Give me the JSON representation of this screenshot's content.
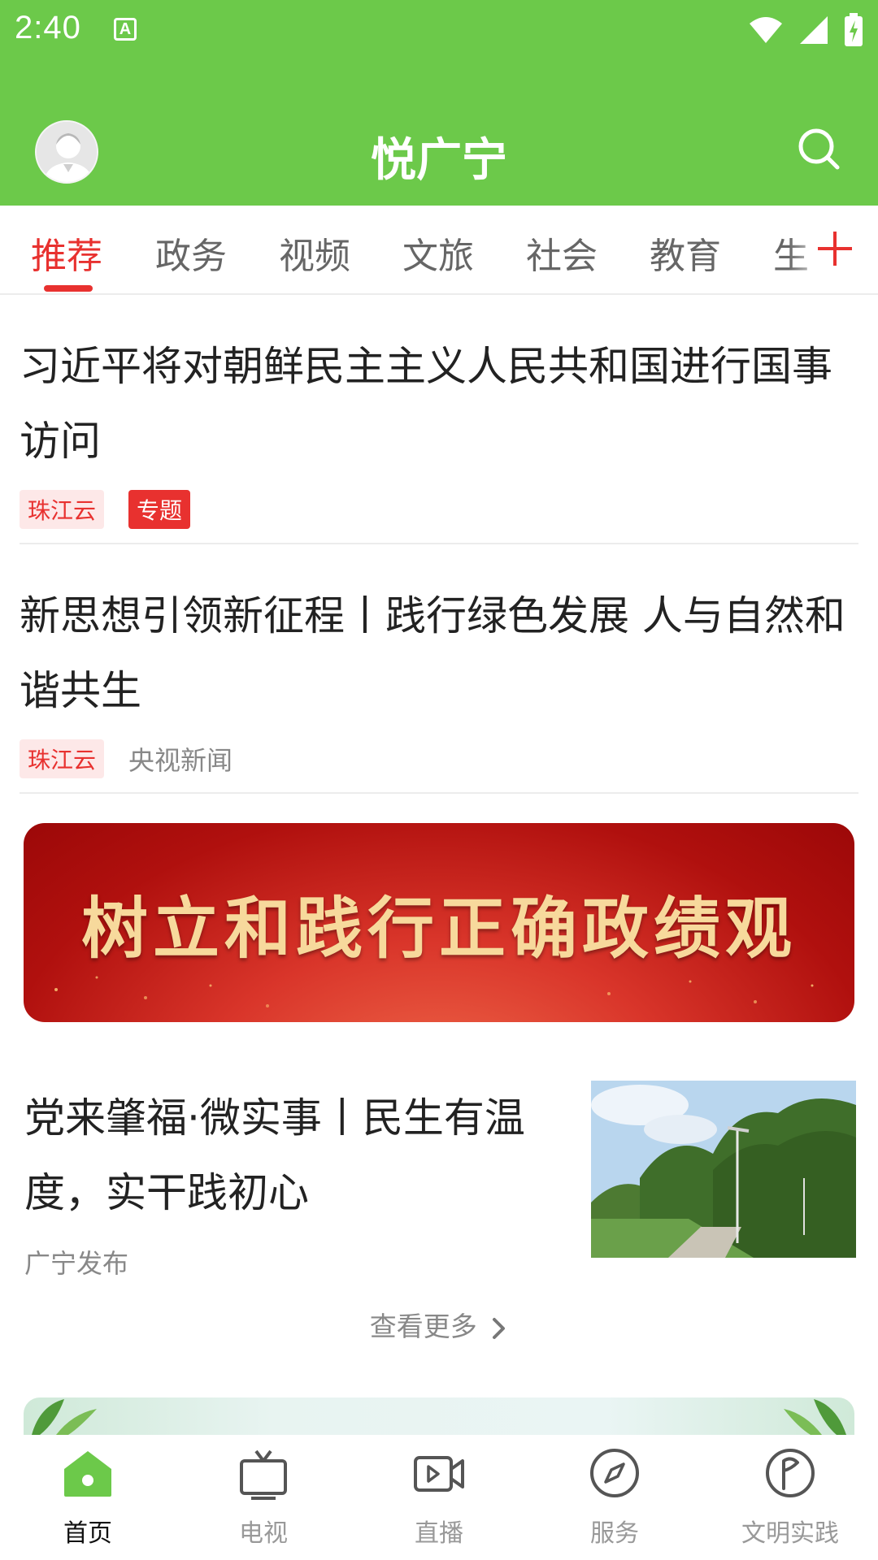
{
  "status_bar": {
    "time": "2:40",
    "notification_icon": "A"
  },
  "header": {
    "title": "悦广宁",
    "accent_color": "#6cc94a"
  },
  "tabs": {
    "items": [
      "推荐",
      "政务",
      "视频",
      "文旅",
      "社会",
      "教育",
      "生"
    ],
    "active": "推荐",
    "active_color": "#e8312f"
  },
  "news": [
    {
      "title": "习近平将对朝鲜民主主义人民共和国进行国事访问",
      "source_tag": "珠江云",
      "special_tag": "专题"
    },
    {
      "title": "新思想引领新征程丨践行绿色发展 人与自然和谐共生",
      "source_tag": "珠江云",
      "publisher": "央视新闻"
    }
  ],
  "banner": {
    "text": "树立和践行正确政绩观"
  },
  "image_news": {
    "title": "党来肇福·微实事丨民生有温度，实干践初心",
    "publisher": "广宁发布"
  },
  "more_label": "查看更多",
  "bottom_nav": [
    {
      "label": "首页",
      "icon": "home-icon",
      "active": true
    },
    {
      "label": "电视",
      "icon": "tv-icon"
    },
    {
      "label": "直播",
      "icon": "live-video-icon"
    },
    {
      "label": "服务",
      "icon": "compass-icon"
    },
    {
      "label": "文明实践",
      "icon": "flag-badge-icon"
    }
  ]
}
